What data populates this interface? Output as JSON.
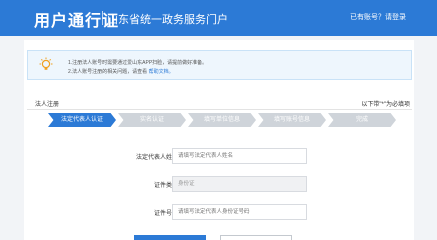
{
  "header": {
    "title": "用户通行证",
    "subtitle": "山东省统一政务服务门户",
    "login_hint": "已有账号？请登录"
  },
  "notice": {
    "line1": "1.注册法人账号时需要通过爱山东APP扫脸，请提前做好准备。",
    "line2_prefix": "2.法人账号注册的相关问题，请查看",
    "line2_link": "帮助文档。"
  },
  "section": {
    "title": "法人注册",
    "required_note": "以下带\"*\"为必填项"
  },
  "steps": [
    {
      "label": "法定代表人认证",
      "active": true
    },
    {
      "label": "实名认证",
      "active": false
    },
    {
      "label": "填写单位信息",
      "active": false
    },
    {
      "label": "填写账号信息",
      "active": false
    },
    {
      "label": "完成",
      "active": false
    }
  ],
  "form": {
    "name": {
      "label": "法定代表人姓名：",
      "placeholder": "请填写法定代表人姓名"
    },
    "id_type": {
      "label": "证件类型：",
      "value": "身份证"
    },
    "id_number": {
      "label": "证件号码：",
      "placeholder": "请填写法定代表人身份证号码"
    }
  },
  "colors": {
    "brand": "#2c7ad6",
    "notice_bg": "#eef6fd",
    "step_inactive": "#cfd4da"
  }
}
